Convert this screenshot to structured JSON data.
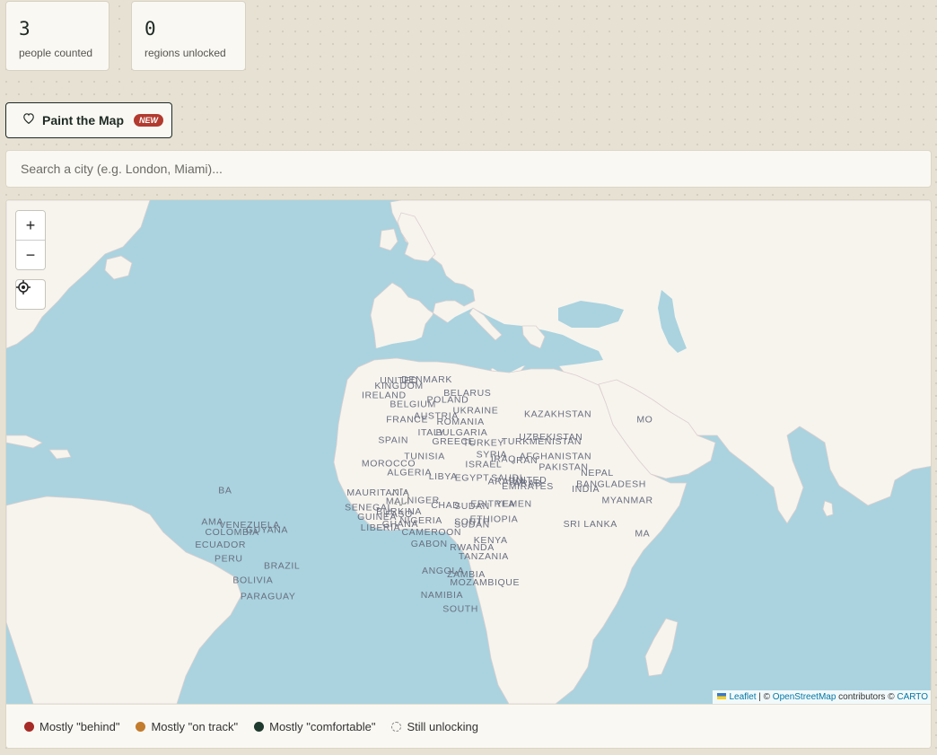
{
  "stats": [
    {
      "value": "3",
      "label": "people counted"
    },
    {
      "value": "0",
      "label": "regions unlocked"
    }
  ],
  "paint_button": {
    "label": "Paint the Map",
    "badge": "NEW",
    "icon": "heart-icon"
  },
  "search": {
    "placeholder": "Search a city (e.g. London, Miami)..."
  },
  "map": {
    "controls": {
      "zoom_in": "+",
      "zoom_out": "−",
      "locate_icon": "crosshair-icon"
    },
    "attribution": {
      "leaflet": "Leaflet",
      "sep": " | © ",
      "osm": "OpenStreetMap",
      "contributors": " contributors © ",
      "carto": "CARTO"
    },
    "colors": {
      "water": "#aad3df",
      "land": "#f7f4ee",
      "border": "#d9c9c9"
    },
    "labels": [
      {
        "text": "UNITED",
        "lon": -1.5,
        "lat": 56.8
      },
      {
        "text": "KINGDOM",
        "lon": -1.5,
        "lat": 55.5
      },
      {
        "text": "IRELAND",
        "lon": -8.0,
        "lat": 53.2
      },
      {
        "text": "DENMARK",
        "lon": 10.5,
        "lat": 57.0
      },
      {
        "text": "BELARUS",
        "lon": 28.0,
        "lat": 53.8
      },
      {
        "text": "POLAND",
        "lon": 19.5,
        "lat": 52.0
      },
      {
        "text": "BELGIUM",
        "lon": 4.5,
        "lat": 50.8
      },
      {
        "text": "UKRAINE",
        "lon": 31.5,
        "lat": 49.0
      },
      {
        "text": "KAZAKHSTAN",
        "lon": 67.0,
        "lat": 48.0
      },
      {
        "text": "AUSTRIA",
        "lon": 14.5,
        "lat": 47.5
      },
      {
        "text": "FRANCE",
        "lon": 2.0,
        "lat": 46.5
      },
      {
        "text": "ROMANIA",
        "lon": 25.0,
        "lat": 45.8
      },
      {
        "text": "ITALY",
        "lon": 12.5,
        "lat": 42.5
      },
      {
        "text": "BULGARIA",
        "lon": 25.5,
        "lat": 42.5
      },
      {
        "text": "UZBEKISTAN",
        "lon": 64.0,
        "lat": 41.0
      },
      {
        "text": "SPAIN",
        "lon": -4.0,
        "lat": 40.0
      },
      {
        "text": "GREECE",
        "lon": 22.0,
        "lat": 39.5
      },
      {
        "text": "TURKEY",
        "lon": 35.0,
        "lat": 39.0
      },
      {
        "text": "TURKMENISTAN",
        "lon": 60.0,
        "lat": 39.5
      },
      {
        "text": "TUNISIA",
        "lon": 9.5,
        "lat": 34.5
      },
      {
        "text": "SYRIA",
        "lon": 38.5,
        "lat": 35.0
      },
      {
        "text": "IRAQ",
        "lon": 43.5,
        "lat": 33.5
      },
      {
        "text": "IRAN",
        "lon": 53.0,
        "lat": 33.0
      },
      {
        "text": "AFGHANISTAN",
        "lon": 66.0,
        "lat": 34.5
      },
      {
        "text": "MOROCCO",
        "lon": -6.0,
        "lat": 31.8
      },
      {
        "text": "ISRAEL",
        "lon": 35.0,
        "lat": 31.5
      },
      {
        "text": "PAKISTAN",
        "lon": 69.5,
        "lat": 30.5
      },
      {
        "text": "ALGERIA",
        "lon": 3.0,
        "lat": 28.5
      },
      {
        "text": "LIBYA",
        "lon": 17.5,
        "lat": 27.0
      },
      {
        "text": "EGYPT",
        "lon": 30.0,
        "lat": 26.5
      },
      {
        "text": "SAUDI",
        "lon": 45.0,
        "lat": 26.5
      },
      {
        "text": "ARABIA",
        "lon": 45.0,
        "lat": 25.0
      },
      {
        "text": "NEPAL",
        "lon": 84.0,
        "lat": 28.3
      },
      {
        "text": "UNITED",
        "lon": 54.0,
        "lat": 25.5
      },
      {
        "text": "ARAB",
        "lon": 54.0,
        "lat": 24.3
      },
      {
        "text": "EMIRATES",
        "lon": 54.0,
        "lat": 23.0
      },
      {
        "text": "BANGLADESH",
        "lon": 90.0,
        "lat": 24.0
      },
      {
        "text": "INDIA",
        "lon": 79.0,
        "lat": 22.0
      },
      {
        "text": "MAURITANIA",
        "lon": -10.5,
        "lat": 20.5
      },
      {
        "text": "MALI",
        "lon": -2.0,
        "lat": 17.0
      },
      {
        "text": "NIGER",
        "lon": 9.0,
        "lat": 17.5
      },
      {
        "text": "CHAD",
        "lon": 18.5,
        "lat": 15.5
      },
      {
        "text": "SUDAN",
        "lon": 30.0,
        "lat": 15.0
      },
      {
        "text": "ERITREA",
        "lon": 39.0,
        "lat": 16.0
      },
      {
        "text": "YEMEN",
        "lon": 48.0,
        "lat": 16.0
      },
      {
        "text": "MYANMAR",
        "lon": 97.0,
        "lat": 17.5
      },
      {
        "text": "SENEGAL",
        "lon": -14.5,
        "lat": 14.5
      },
      {
        "text": "BURKINA",
        "lon": -1.5,
        "lat": 12.8
      },
      {
        "text": "FASO",
        "lon": -1.5,
        "lat": 11.6
      },
      {
        "text": "GUINEA",
        "lon": -11.0,
        "lat": 10.5
      },
      {
        "text": "ETHIOPIA",
        "lon": 39.5,
        "lat": 9.5
      },
      {
        "text": "NIGERIA",
        "lon": 8.0,
        "lat": 9.0
      },
      {
        "text": "GHANA",
        "lon": -1.0,
        "lat": 7.5
      },
      {
        "text": "SOUTH",
        "lon": 30.0,
        "lat": 8.5
      },
      {
        "text": "SUDAN",
        "lon": 30.0,
        "lat": 7.3
      },
      {
        "text": "SRI LANKA",
        "lon": 81.0,
        "lat": 7.5
      },
      {
        "text": "VENEZUELA",
        "lon": -66.0,
        "lat": 7.0
      },
      {
        "text": "LIBERIA",
        "lon": -9.5,
        "lat": 6.0
      },
      {
        "text": "GUYANA",
        "lon": -58.5,
        "lat": 5.0
      },
      {
        "text": "COLOMBIA",
        "lon": -73.5,
        "lat": 4.0
      },
      {
        "text": "CAMEROON",
        "lon": 12.5,
        "lat": 4.0
      },
      {
        "text": "KENYA",
        "lon": 38.0,
        "lat": 0.5
      },
      {
        "text": "GABON",
        "lon": 11.5,
        "lat": -1.0
      },
      {
        "text": "ECUADOR",
        "lon": -78.5,
        "lat": -1.5
      },
      {
        "text": "RWANDA",
        "lon": 30.0,
        "lat": -2.5
      },
      {
        "text": "PERU",
        "lon": -75.0,
        "lat": -7.5
      },
      {
        "text": "TANZANIA",
        "lon": 35.0,
        "lat": -6.5
      },
      {
        "text": "BRAZIL",
        "lon": -52.0,
        "lat": -10.5
      },
      {
        "text": "ANGOLA",
        "lon": 17.5,
        "lat": -12.5
      },
      {
        "text": "ZAMBIA",
        "lon": 27.5,
        "lat": -14.0
      },
      {
        "text": "BOLIVIA",
        "lon": -64.5,
        "lat": -16.5
      },
      {
        "text": "MOZAMBIQUE",
        "lon": 35.5,
        "lat": -17.5
      },
      {
        "text": "PARAGUAY",
        "lon": -58.0,
        "lat": -23.0
      },
      {
        "text": "NAMIBIA",
        "lon": 17.0,
        "lat": -22.5
      },
      {
        "text": "SOUTH",
        "lon": 25.0,
        "lat": -28.0
      },
      {
        "text": "MO",
        "lon": 104.5,
        "lat": 46.5
      },
      {
        "text": "BA",
        "lon": -76.5,
        "lat": 21.5
      },
      {
        "text": "AMA",
        "lon": -82.0,
        "lat": 8.5
      },
      {
        "text": "MA",
        "lon": 103.5,
        "lat": 3.5
      }
    ],
    "unlocking_marker": {
      "lon": -1.0,
      "lat": 20.0
    }
  },
  "legend": [
    {
      "label": "Mostly \"behind\"",
      "color": "#a72b26",
      "style": "solid"
    },
    {
      "label": "Mostly \"on track\"",
      "color": "#c37b2e",
      "style": "solid"
    },
    {
      "label": "Mostly \"comfortable\"",
      "color": "#1f3a2e",
      "style": "solid"
    },
    {
      "label": "Still unlocking",
      "color": "#888888",
      "style": "dashed"
    }
  ]
}
